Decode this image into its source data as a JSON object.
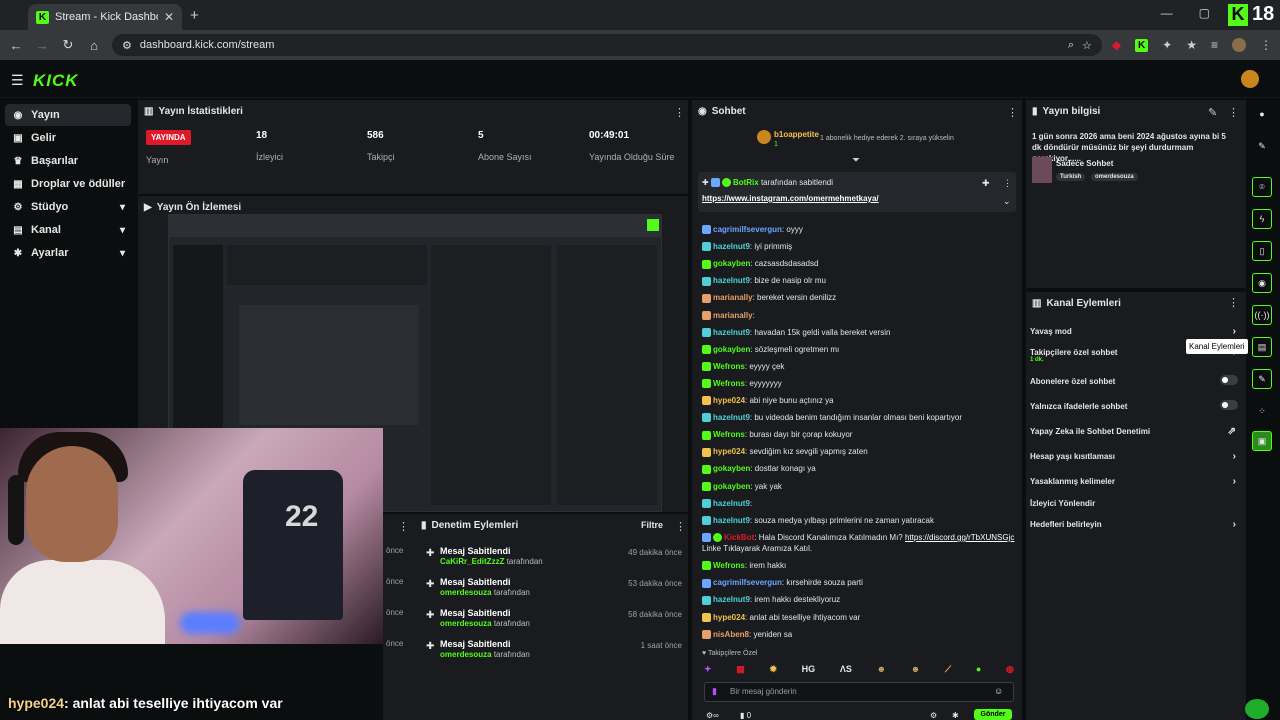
{
  "browser": {
    "tab_title": "Stream - Kick Dashboard",
    "url": "dashboard.kick.com/stream",
    "brand_badge": "18"
  },
  "header": {
    "logo": "KICK"
  },
  "sidebar": {
    "items": [
      {
        "label": "Yayın",
        "icon": "antenna-icon"
      },
      {
        "label": "Gelir",
        "icon": "money-icon"
      },
      {
        "label": "Başarılar",
        "icon": "trophy-icon"
      },
      {
        "label": "Droplar ve ödüller",
        "icon": "gift-icon"
      },
      {
        "label": "Stüdyo",
        "icon": "studio-icon"
      },
      {
        "label": "Kanal",
        "icon": "channel-icon"
      },
      {
        "label": "Ayarlar",
        "icon": "gear-icon"
      }
    ]
  },
  "stats": {
    "title": "Yayın İstatistikleri",
    "live_label": "YAYINDA",
    "stream_label": "Yayın",
    "viewers": "18",
    "viewers_label": "İzleyici",
    "followers": "586",
    "followers_label": "Takipçi",
    "subs": "5",
    "subs_label": "Abone Sayısı",
    "uptime": "00:49:01",
    "uptime_label": "Yayında Olduğu Süre"
  },
  "preview": {
    "title": "Yayın Ön İzlemesi"
  },
  "moderation": {
    "title": "Denetim Eylemleri",
    "filter": "Filtre",
    "items": [
      {
        "title": "Mesaj Sabitlendi",
        "user": "CaKiRr_EditZzzZ",
        "suffix": "tarafından",
        "time": "49 dakika önce"
      },
      {
        "title": "Mesaj Sabitlendi",
        "user": "omerdesouza",
        "suffix": "tarafından",
        "time": "53 dakika önce"
      },
      {
        "title": "Mesaj Sabitlendi",
        "user": "omerdesouza",
        "suffix": "tarafından",
        "time": "58 dakika önce"
      },
      {
        "title": "Mesaj Sabitlendi",
        "user": "omerdesouza",
        "suffix": "tarafından",
        "time": "1 saat önce"
      }
    ],
    "partial": [
      "önce",
      "önce",
      "önce",
      "önce"
    ]
  },
  "chat": {
    "title": "Sohbet",
    "gift_user": "b1oappetite",
    "gift_count": "1",
    "gift_text": "1 abonelik hediye ederek 2. sıraya yükselin",
    "pinned_by": "BotRix",
    "pinned_suffix": "tarafından sabitlendi",
    "pinned_link": "https://www.instagram.com/omermehmetkaya/",
    "messages": [
      {
        "user": "cagrimilfsevergun",
        "text": "oyyy",
        "color": "#6aa7ff"
      },
      {
        "user": "hazelnut9",
        "text": "iyi primmiş",
        "color": "#4fd0d8"
      },
      {
        "user": "gokayben",
        "text": "cazsasdsdasadsd",
        "color": "#53fc18"
      },
      {
        "user": "hazelnut9",
        "text": "bize de nasip olr mu",
        "color": "#4fd0d8"
      },
      {
        "user": "marianally",
        "text": "bereket versin denilizz",
        "color": "#e6a06a"
      },
      {
        "user": "marianally",
        "text": "",
        "color": "#e6a06a"
      },
      {
        "user": "hazelnut9",
        "text": "havadan 15k geldi valla bereket versin",
        "color": "#4fd0d8"
      },
      {
        "user": "gokayben",
        "text": "sözleşmeli ogretmen mı",
        "color": "#53fc18"
      },
      {
        "user": "Wefrons",
        "text": "eyyyy çek",
        "color": "#53fc18"
      },
      {
        "user": "Wefrons",
        "text": "eyyyyyyy",
        "color": "#53fc18"
      },
      {
        "user": "hype024",
        "text": "abi niye bunu açtınız ya",
        "color": "#f2c14e"
      },
      {
        "user": "hazelnut9",
        "text": "bu videoda benim tandığım insanlar olması beni kopartıyor",
        "color": "#4fd0d8"
      },
      {
        "user": "Wefrons",
        "text": "burası dayı bir çorap kokuyor",
        "color": "#53fc18"
      },
      {
        "user": "hype024",
        "text": "sevdiğim kız sevgili yapmış zaten",
        "color": "#f2c14e"
      },
      {
        "user": "gokayben",
        "text": "dostlar konagı ya",
        "color": "#53fc18"
      },
      {
        "user": "gokayben",
        "text": "yak yak",
        "color": "#53fc18"
      },
      {
        "user": "hazelnut9",
        "text": "",
        "color": "#4fd0d8"
      },
      {
        "user": "hazelnut9",
        "text": "souza medya yılbaşı primlerini ne zaman yatıracak",
        "color": "#4fd0d8"
      }
    ],
    "botrix_user": "KickBot",
    "botrix_text": "Hala Discord Kanalımıza Katılmadın Mı?",
    "botrix_link": "https://discord.gg/rTbXUNSGjc",
    "botrix_tail": "Linke Tıklayarak Aramıza Katıl.",
    "messages2": [
      {
        "user": "Wefrons",
        "text": "irem hakkı",
        "color": "#53fc18"
      },
      {
        "user": "cagrimilfsevergun",
        "text": "kırsehirde souza parti",
        "color": "#6aa7ff"
      },
      {
        "user": "hazelnut9",
        "text": "irem hakkı destekliyoruz",
        "color": "#4fd0d8"
      },
      {
        "user": "hype024",
        "text": "anlat abi teselliye ihtiyacom var",
        "color": "#f2c14e"
      },
      {
        "user": "nisAben8",
        "text": "yeniden sa",
        "color": "#e6a06a"
      }
    ],
    "followers_only": "Takipçilere Özel",
    "emotes": [
      "HG",
      "ΛS"
    ],
    "input_placeholder": "Bir mesaj gönderin",
    "send_label": "Gönder",
    "footer_count": "0"
  },
  "stream_info": {
    "title": "Yayın bilgisi",
    "description": "1 gün sonra 2026 ama beni 2024 ağustos ayına bi 5 dk döndürür müsünüz bir şeyi durdurmam gerekiyor......",
    "category": "Sadece Sohbet",
    "tags": [
      "Turkish",
      "omerdesouza"
    ]
  },
  "channel_actions": {
    "title": "Kanal Eylemleri",
    "tooltip": "Kanal Eylemleri",
    "items": [
      {
        "label": "Yavaş mod",
        "type": "arrow"
      },
      {
        "label": "Takipçilere özel sohbet",
        "sub": "1 dk.",
        "type": "arrow"
      },
      {
        "label": "Abonelere özel sohbet",
        "type": "toggle"
      },
      {
        "label": "Yalnızca ifadelerle sohbet",
        "type": "toggle"
      },
      {
        "label": "Yapay Zeka ile Sohbet Denetimi",
        "type": "external"
      },
      {
        "label": "Hesap yaşı kısıtlaması",
        "type": "arrow"
      },
      {
        "label": "Yasaklanmış kelimeler",
        "type": "arrow"
      },
      {
        "label": "İzleyici Yönlendir",
        "type": "none"
      },
      {
        "label": "Hedefleri belirleyin",
        "type": "arrow"
      }
    ]
  },
  "caption": {
    "user": "hype024",
    "text": ": anlat abi teselliye ihtiyacom var"
  },
  "colors": {
    "kick_green": "#53fc18",
    "live_red": "#e0192a",
    "panel": "#191b1f",
    "background": "#0b0e0f"
  }
}
